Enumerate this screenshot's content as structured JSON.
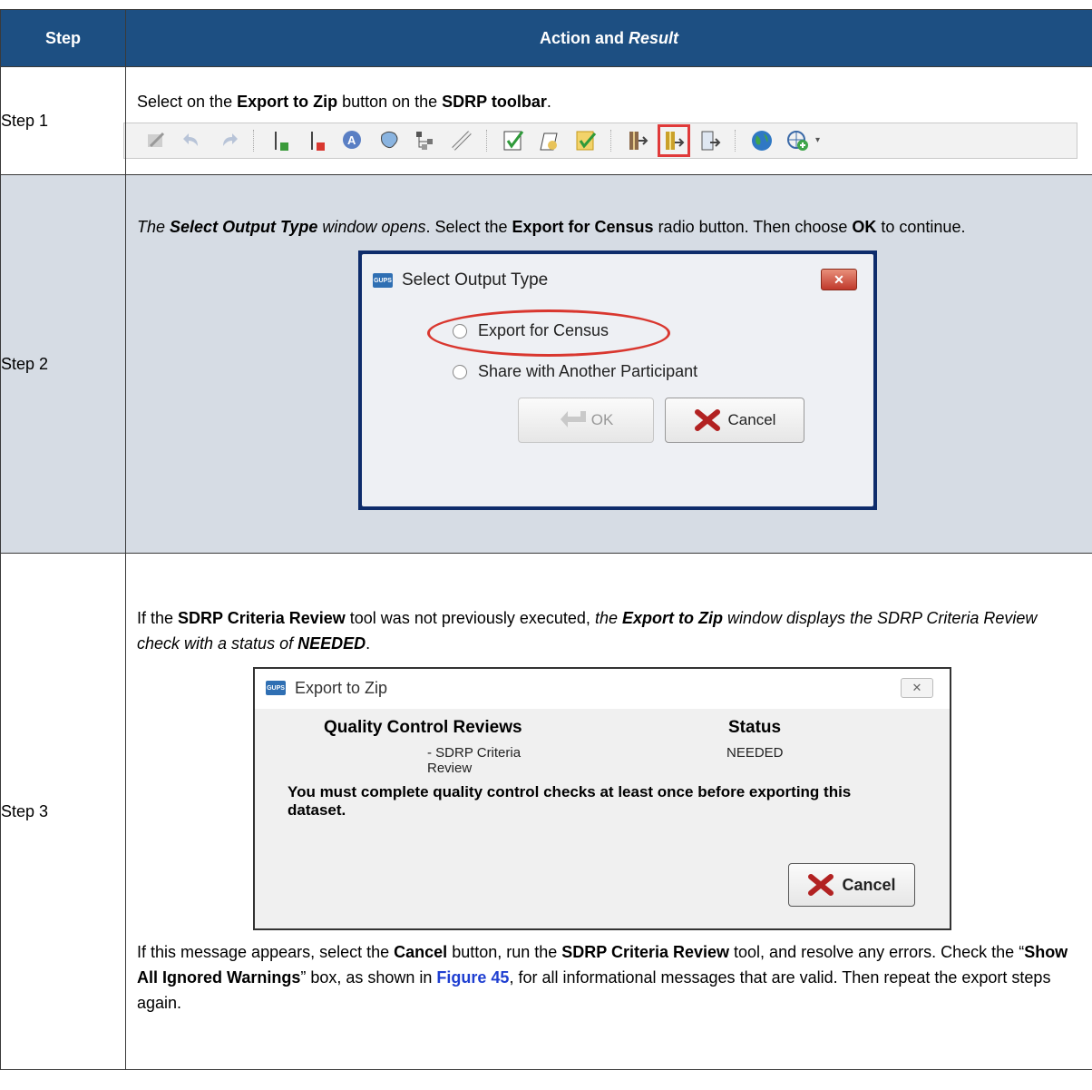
{
  "header": {
    "step": "Step",
    "action_prefix": "Action and ",
    "action_italic": "Result"
  },
  "rows": [
    {
      "step": "Step 1",
      "t1": "Select on the ",
      "b1": "Export to Zip",
      "t2": " button on the ",
      "b2": "SDRP toolbar",
      "t3": "."
    },
    {
      "step": "Step 2",
      "i1": "The ",
      "ib1": "Select Output Type",
      "i2": " window opens",
      "t1": ". Select the ",
      "b1": "Export for Census",
      "t2": " radio button. Then choose ",
      "b2": "OK",
      "t3": " to continue."
    },
    {
      "step": "Step 3",
      "t1": "If the ",
      "b1": "SDRP Criteria Review",
      "t2": " tool was not previously executed, ",
      "i1": "the ",
      "ib1": "Export to Zip",
      "i2": " window displays the SDRP Criteria Review check with a status of ",
      "ib2": "NEEDED",
      "t3": ".",
      "p2": {
        "t1": "If this message appears, select the ",
        "b1": "Cancel",
        "t2": " button, run the ",
        "b2": "SDRP Criteria Review",
        "t3": " tool, and resolve any errors. Check the “",
        "b3": "Show All Ignored Warnings",
        "t4": "” box, as shown in ",
        "link": "Figure 45",
        "t5": ", for all informational messages that are valid. Then repeat the export steps again."
      }
    }
  ],
  "dialog_output": {
    "app_icon": "GUPS",
    "title": "Select Output Type",
    "close": "✕",
    "option1": "Export for Census",
    "option2": "Share with Another Participant",
    "ok": "OK",
    "cancel": "Cancel"
  },
  "dialog_zip": {
    "app_icon": "GUPS",
    "title": "Export to Zip",
    "close": "✕",
    "col1": "Quality Control Reviews",
    "col2": "Status",
    "item": "- SDRP Criteria Review",
    "status": "NEEDED",
    "message": "You must complete quality control checks at least once before exporting this dataset.",
    "cancel": "Cancel"
  },
  "toolbar_icons": [
    "edit-icon",
    "undo-icon",
    "redo-icon",
    "add-layer-icon",
    "remove-layer-icon",
    "annotation-icon",
    "map-shape-icon",
    "hierarchy-icon",
    "ruler-icon",
    "criteria-check-icon",
    "page-check-icon",
    "yellow-check-icon",
    "import-zip-icon",
    "export-zip-icon",
    "export-doc-icon",
    "globe-icon",
    "add-globe-icon"
  ],
  "colors": {
    "header_bg": "#1d4f82",
    "shade_row": "#d6dce4",
    "highlight": "#e03a3a"
  }
}
